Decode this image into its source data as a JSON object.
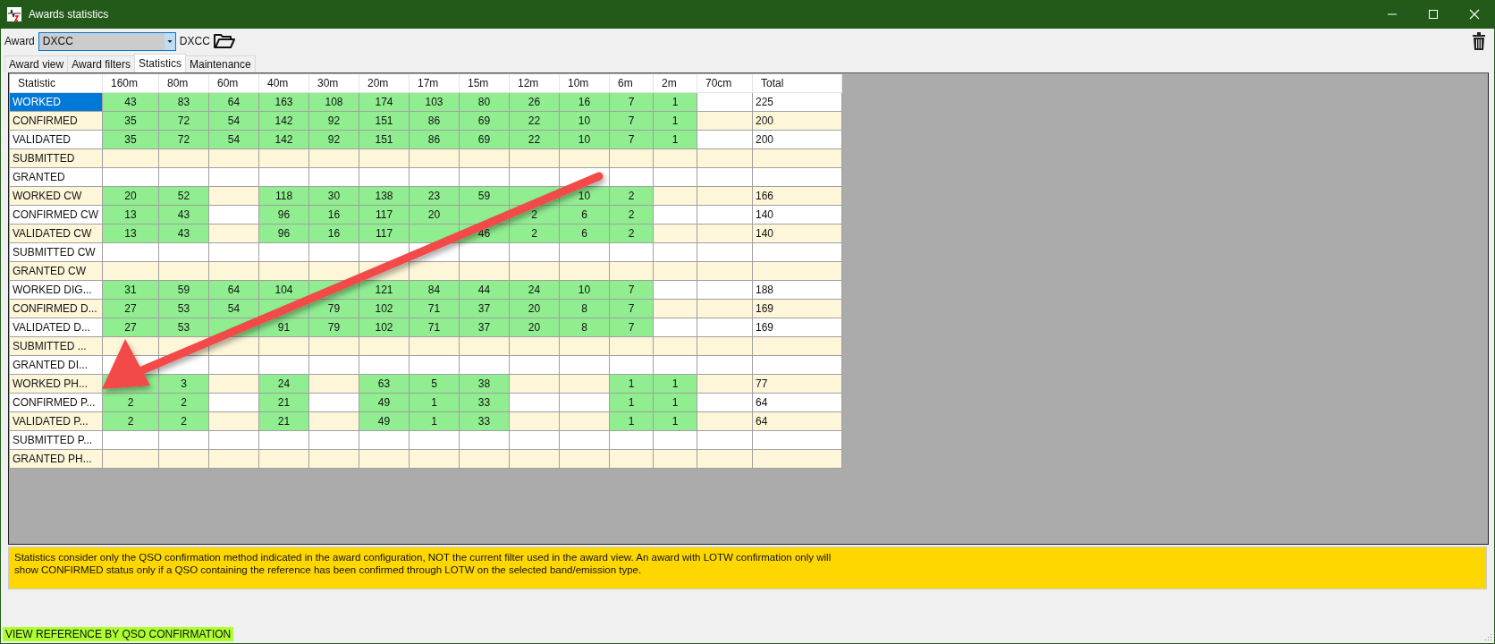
{
  "window": {
    "title": "Awards statistics"
  },
  "toolbar": {
    "award_label": "Award",
    "award_value": "DXCC",
    "award_name": "DXCC"
  },
  "tabs": [
    {
      "label": "Award view",
      "selected": false
    },
    {
      "label": "Award filters",
      "selected": false
    },
    {
      "label": "Statistics",
      "selected": true
    },
    {
      "label": "Maintenance",
      "selected": false
    }
  ],
  "table": {
    "statistic_header": "Statistic",
    "band_headers": [
      "160m",
      "80m",
      "60m",
      "40m",
      "30m",
      "20m",
      "17m",
      "15m",
      "12m",
      "10m",
      "6m",
      "2m",
      "70cm"
    ],
    "total_header": "Total",
    "rows": [
      {
        "label": "WORKED",
        "selected": true,
        "cells": [
          {
            "filled": true,
            "value": "43"
          },
          {
            "filled": true,
            "value": "83"
          },
          {
            "filled": true,
            "value": "64"
          },
          {
            "filled": true,
            "value": "163"
          },
          {
            "filled": true,
            "value": "108"
          },
          {
            "filled": true,
            "value": "174"
          },
          {
            "filled": true,
            "value": "103"
          },
          {
            "filled": true,
            "value": "80"
          },
          {
            "filled": true,
            "value": "26"
          },
          {
            "filled": true,
            "value": "16"
          },
          {
            "filled": true,
            "value": "7"
          },
          {
            "filled": true,
            "value": "1"
          },
          {
            "filled": false
          }
        ],
        "total": "225"
      },
      {
        "label": "CONFIRMED",
        "selected": false,
        "cells": [
          {
            "filled": true,
            "value": "35"
          },
          {
            "filled": true,
            "value": "72"
          },
          {
            "filled": true,
            "value": "54"
          },
          {
            "filled": true,
            "value": "142"
          },
          {
            "filled": true,
            "value": "92"
          },
          {
            "filled": true,
            "value": "151"
          },
          {
            "filled": true,
            "value": "86"
          },
          {
            "filled": true,
            "value": "69"
          },
          {
            "filled": true,
            "value": "22"
          },
          {
            "filled": true,
            "value": "10"
          },
          {
            "filled": true,
            "value": "7"
          },
          {
            "filled": true,
            "value": "1"
          },
          {
            "filled": false
          }
        ],
        "total": "200"
      },
      {
        "label": "VALIDATED",
        "selected": false,
        "cells": [
          {
            "filled": true,
            "value": "35"
          },
          {
            "filled": true,
            "value": "72"
          },
          {
            "filled": true,
            "value": "54"
          },
          {
            "filled": true,
            "value": "142"
          },
          {
            "filled": true,
            "value": "92"
          },
          {
            "filled": true,
            "value": "151"
          },
          {
            "filled": true,
            "value": "86"
          },
          {
            "filled": true,
            "value": "69"
          },
          {
            "filled": true,
            "value": "22"
          },
          {
            "filled": true,
            "value": "10"
          },
          {
            "filled": true,
            "value": "7"
          },
          {
            "filled": true,
            "value": "1"
          },
          {
            "filled": false
          }
        ],
        "total": "200"
      },
      {
        "label": "SUBMITTED",
        "selected": false,
        "cells": [
          {
            "filled": false
          },
          {
            "filled": false
          },
          {
            "filled": false
          },
          {
            "filled": false
          },
          {
            "filled": false
          },
          {
            "filled": false
          },
          {
            "filled": false
          },
          {
            "filled": false
          },
          {
            "filled": false
          },
          {
            "filled": false
          },
          {
            "filled": false
          },
          {
            "filled": false
          },
          {
            "filled": false
          }
        ]
      },
      {
        "label": "GRANTED",
        "selected": false,
        "cells": [
          {
            "filled": false
          },
          {
            "filled": false
          },
          {
            "filled": false
          },
          {
            "filled": false
          },
          {
            "filled": false
          },
          {
            "filled": false
          },
          {
            "filled": false
          },
          {
            "filled": false
          },
          {
            "filled": false
          },
          {
            "filled": false
          },
          {
            "filled": false
          },
          {
            "filled": false
          },
          {
            "filled": false
          }
        ]
      },
      {
        "label": "WORKED CW",
        "selected": false,
        "cells": [
          {
            "filled": true,
            "value": "20"
          },
          {
            "filled": true,
            "value": "52"
          },
          {
            "filled": false
          },
          {
            "filled": true,
            "value": "118"
          },
          {
            "filled": true,
            "value": "30"
          },
          {
            "filled": true,
            "value": "138"
          },
          {
            "filled": true,
            "value": "23"
          },
          {
            "filled": true,
            "value": "59"
          },
          {
            "filled": true
          },
          {
            "filled": true,
            "value": "10"
          },
          {
            "filled": true,
            "value": "2"
          },
          {
            "filled": false
          },
          {
            "filled": false
          }
        ],
        "total": "166"
      },
      {
        "label": "CONFIRMED CW",
        "selected": false,
        "cells": [
          {
            "filled": true,
            "value": "13"
          },
          {
            "filled": true,
            "value": "43"
          },
          {
            "filled": false
          },
          {
            "filled": true,
            "value": "96"
          },
          {
            "filled": true,
            "value": "16"
          },
          {
            "filled": true,
            "value": "117"
          },
          {
            "filled": true,
            "value": "20"
          },
          {
            "filled": true
          },
          {
            "filled": true,
            "value": "2"
          },
          {
            "filled": true,
            "value": "6"
          },
          {
            "filled": true,
            "value": "2"
          },
          {
            "filled": false
          },
          {
            "filled": false
          }
        ],
        "total": "140"
      },
      {
        "label": "VALIDATED CW",
        "selected": false,
        "cells": [
          {
            "filled": true,
            "value": "13"
          },
          {
            "filled": true,
            "value": "43"
          },
          {
            "filled": false
          },
          {
            "filled": true,
            "value": "96"
          },
          {
            "filled": true,
            "value": "16"
          },
          {
            "filled": true,
            "value": "117"
          },
          {
            "filled": true
          },
          {
            "filled": true,
            "value": "46"
          },
          {
            "filled": true,
            "value": "2"
          },
          {
            "filled": true,
            "value": "6"
          },
          {
            "filled": true,
            "value": "2"
          },
          {
            "filled": false
          },
          {
            "filled": false
          }
        ],
        "total": "140"
      },
      {
        "label": "SUBMITTED CW",
        "selected": false,
        "cells": [
          {
            "filled": false
          },
          {
            "filled": false
          },
          {
            "filled": false
          },
          {
            "filled": false
          },
          {
            "filled": false
          },
          {
            "filled": false
          },
          {
            "filled": false
          },
          {
            "filled": false
          },
          {
            "filled": false
          },
          {
            "filled": false
          },
          {
            "filled": false
          },
          {
            "filled": false
          },
          {
            "filled": false
          }
        ]
      },
      {
        "label": "GRANTED CW",
        "selected": false,
        "cells": [
          {
            "filled": false
          },
          {
            "filled": false
          },
          {
            "filled": false
          },
          {
            "filled": false
          },
          {
            "filled": false
          },
          {
            "filled": false
          },
          {
            "filled": false
          },
          {
            "filled": false
          },
          {
            "filled": false
          },
          {
            "filled": false
          },
          {
            "filled": false
          },
          {
            "filled": false
          },
          {
            "filled": false
          }
        ]
      },
      {
        "label": "WORKED DIG...",
        "selected": false,
        "cells": [
          {
            "filled": true,
            "value": "31"
          },
          {
            "filled": true,
            "value": "59"
          },
          {
            "filled": true,
            "value": "64"
          },
          {
            "filled": true,
            "value": "104"
          },
          {
            "filled": true
          },
          {
            "filled": true,
            "value": "121"
          },
          {
            "filled": true,
            "value": "84"
          },
          {
            "filled": true,
            "value": "44"
          },
          {
            "filled": true,
            "value": "24"
          },
          {
            "filled": true,
            "value": "10"
          },
          {
            "filled": true,
            "value": "7"
          },
          {
            "filled": false
          },
          {
            "filled": false
          }
        ],
        "total": "188"
      },
      {
        "label": "CONFIRMED D...",
        "selected": false,
        "cells": [
          {
            "filled": true,
            "value": "27"
          },
          {
            "filled": true,
            "value": "53"
          },
          {
            "filled": true,
            "value": "54"
          },
          {
            "filled": true
          },
          {
            "filled": true,
            "value": "79"
          },
          {
            "filled": true,
            "value": "102"
          },
          {
            "filled": true,
            "value": "71"
          },
          {
            "filled": true,
            "value": "37"
          },
          {
            "filled": true,
            "value": "20"
          },
          {
            "filled": true,
            "value": "8"
          },
          {
            "filled": true,
            "value": "7"
          },
          {
            "filled": false
          },
          {
            "filled": false
          }
        ],
        "total": "169"
      },
      {
        "label": "VALIDATED D...",
        "selected": false,
        "cells": [
          {
            "filled": true,
            "value": "27"
          },
          {
            "filled": true,
            "value": "53"
          },
          {
            "filled": true
          },
          {
            "filled": true,
            "value": "91"
          },
          {
            "filled": true,
            "value": "79"
          },
          {
            "filled": true,
            "value": "102"
          },
          {
            "filled": true,
            "value": "71"
          },
          {
            "filled": true,
            "value": "37"
          },
          {
            "filled": true,
            "value": "20"
          },
          {
            "filled": true,
            "value": "8"
          },
          {
            "filled": true,
            "value": "7"
          },
          {
            "filled": false
          },
          {
            "filled": false
          }
        ],
        "total": "169"
      },
      {
        "label": "SUBMITTED ...",
        "selected": false,
        "cells": [
          {
            "filled": false
          },
          {
            "filled": false
          },
          {
            "filled": false
          },
          {
            "filled": false
          },
          {
            "filled": false
          },
          {
            "filled": false
          },
          {
            "filled": false
          },
          {
            "filled": false
          },
          {
            "filled": false
          },
          {
            "filled": false
          },
          {
            "filled": false
          },
          {
            "filled": false
          },
          {
            "filled": false
          }
        ]
      },
      {
        "label": "GRANTED DI...",
        "selected": false,
        "cells": [
          {
            "filled": false
          },
          {
            "filled": false
          },
          {
            "filled": false
          },
          {
            "filled": false
          },
          {
            "filled": false
          },
          {
            "filled": false
          },
          {
            "filled": false
          },
          {
            "filled": false
          },
          {
            "filled": false
          },
          {
            "filled": false
          },
          {
            "filled": false
          },
          {
            "filled": false
          },
          {
            "filled": false
          }
        ]
      },
      {
        "label": "WORKED PH...",
        "selected": false,
        "cells": [
          {
            "filled": true
          },
          {
            "filled": true,
            "value": "3"
          },
          {
            "filled": false
          },
          {
            "filled": true,
            "value": "24"
          },
          {
            "filled": false
          },
          {
            "filled": true,
            "value": "63"
          },
          {
            "filled": true,
            "value": "5"
          },
          {
            "filled": true,
            "value": "38"
          },
          {
            "filled": false
          },
          {
            "filled": false
          },
          {
            "filled": true,
            "value": "1"
          },
          {
            "filled": true,
            "value": "1"
          },
          {
            "filled": false
          }
        ],
        "total": "77"
      },
      {
        "label": "CONFIRMED P...",
        "selected": false,
        "cells": [
          {
            "filled": true,
            "value": "2"
          },
          {
            "filled": true,
            "value": "2"
          },
          {
            "filled": false
          },
          {
            "filled": true,
            "value": "21"
          },
          {
            "filled": false
          },
          {
            "filled": true,
            "value": "49"
          },
          {
            "filled": true,
            "value": "1"
          },
          {
            "filled": true,
            "value": "33"
          },
          {
            "filled": false
          },
          {
            "filled": false
          },
          {
            "filled": true,
            "value": "1"
          },
          {
            "filled": true,
            "value": "1"
          },
          {
            "filled": false
          }
        ],
        "total": "64"
      },
      {
        "label": "VALIDATED P...",
        "selected": false,
        "cells": [
          {
            "filled": true,
            "value": "2"
          },
          {
            "filled": true,
            "value": "2"
          },
          {
            "filled": false
          },
          {
            "filled": true,
            "value": "21"
          },
          {
            "filled": false
          },
          {
            "filled": true,
            "value": "49"
          },
          {
            "filled": true,
            "value": "1"
          },
          {
            "filled": true,
            "value": "33"
          },
          {
            "filled": false
          },
          {
            "filled": false
          },
          {
            "filled": true,
            "value": "1"
          },
          {
            "filled": true,
            "value": "1"
          },
          {
            "filled": false
          }
        ],
        "total": "64"
      },
      {
        "label": "SUBMITTED P...",
        "selected": false,
        "cells": [
          {
            "filled": false
          },
          {
            "filled": false
          },
          {
            "filled": false
          },
          {
            "filled": false
          },
          {
            "filled": false
          },
          {
            "filled": false
          },
          {
            "filled": false
          },
          {
            "filled": false
          },
          {
            "filled": false
          },
          {
            "filled": false
          },
          {
            "filled": false
          },
          {
            "filled": false
          },
          {
            "filled": false
          }
        ]
      },
      {
        "label": "GRANTED PH...",
        "selected": false,
        "cells": [
          {
            "filled": false
          },
          {
            "filled": false
          },
          {
            "filled": false
          },
          {
            "filled": false
          },
          {
            "filled": false
          },
          {
            "filled": false
          },
          {
            "filled": false
          },
          {
            "filled": false
          },
          {
            "filled": false
          },
          {
            "filled": false
          },
          {
            "filled": false
          },
          {
            "filled": false
          },
          {
            "filled": false
          }
        ]
      }
    ]
  },
  "notice": "Statistics consider only the QSO confirmation method indicated in the award configuration, NOT the current filter used in the award view. An award with LOTW confirmation only will\nshow CONFIRMED status only if a QSO containing the reference has been confirmed through LOTW on the selected band/emission type.",
  "status_bar": "VIEW REFERENCE BY QSO CONFIRMATION"
}
